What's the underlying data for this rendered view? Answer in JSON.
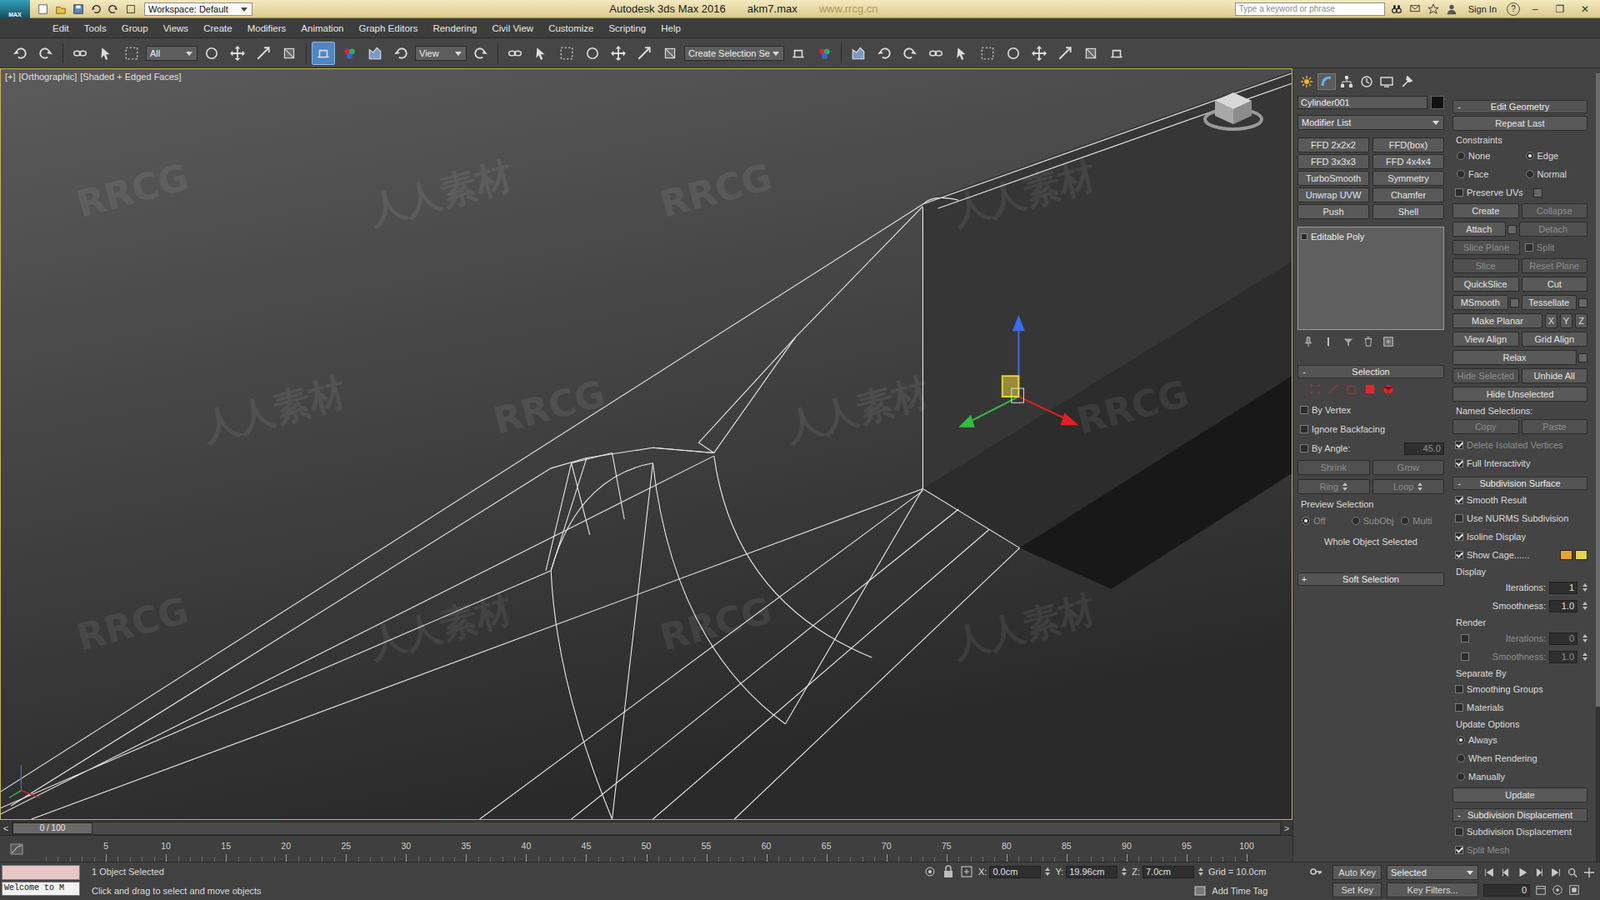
{
  "window": {
    "logo": "MAX",
    "workspace": "Workspace: Default",
    "title": "Autodesk 3ds Max 2016",
    "file": "akm7.max",
    "watermark_url": "www.rrcg.cn",
    "search_placeholder": "Type a keyword or phrase",
    "sign_in": "Sign In",
    "help": "?",
    "controls": [
      "–",
      "❐",
      "✕"
    ]
  },
  "menu": [
    "Edit",
    "Tools",
    "Group",
    "Views",
    "Create",
    "Modifiers",
    "Animation",
    "Graph Editors",
    "Rendering",
    "Civil View",
    "Customize",
    "Scripting",
    "Help"
  ],
  "toolbar": [
    {
      "kind": "tool",
      "selected": false
    },
    {
      "kind": "tool",
      "selected": false
    },
    {
      "kind": "sep"
    },
    {
      "kind": "tool",
      "selected": false
    },
    {
      "kind": "tool",
      "selected": false
    },
    {
      "kind": "tool",
      "selected": false
    },
    {
      "kind": "dropdown",
      "label": "All"
    },
    {
      "kind": "tool",
      "selected": false
    },
    {
      "kind": "tool",
      "selected": false
    },
    {
      "kind": "tool",
      "selected": false
    },
    {
      "kind": "tool",
      "selected": false
    },
    {
      "kind": "sep"
    },
    {
      "kind": "tool",
      "selected": true
    },
    {
      "kind": "tool",
      "selected": false
    },
    {
      "kind": "tool",
      "selected": false
    },
    {
      "kind": "tool",
      "selected": false
    },
    {
      "kind": "dropdown",
      "label": "View"
    },
    {
      "kind": "tool",
      "selected": false
    },
    {
      "kind": "sep"
    },
    {
      "kind": "tool",
      "selected": false
    },
    {
      "kind": "tool",
      "selected": false
    },
    {
      "kind": "tool",
      "selected": false
    },
    {
      "kind": "tool",
      "selected": false
    },
    {
      "kind": "tool",
      "selected": false
    },
    {
      "kind": "tool",
      "selected": false
    },
    {
      "kind": "tool",
      "selected": false
    },
    {
      "kind": "dropdown",
      "label": "Create Selection Se"
    },
    {
      "kind": "tool",
      "selected": false
    },
    {
      "kind": "tool",
      "selected": false
    },
    {
      "kind": "sep"
    },
    {
      "kind": "tool",
      "selected": false
    },
    {
      "kind": "tool",
      "selected": false
    },
    {
      "kind": "tool",
      "selected": false
    },
    {
      "kind": "tool",
      "selected": false
    },
    {
      "kind": "tool",
      "selected": false
    },
    {
      "kind": "tool",
      "selected": false
    },
    {
      "kind": "tool",
      "selected": false
    },
    {
      "kind": "tool",
      "selected": false
    },
    {
      "kind": "tool",
      "selected": false
    },
    {
      "kind": "tool",
      "selected": false
    },
    {
      "kind": "tool",
      "selected": false
    }
  ],
  "viewport": {
    "labels": [
      "[+]",
      "[Orthographic]",
      "[Shaded + Edged Faces]"
    ],
    "watermarks": [
      "RRCG",
      "人人素材",
      "RRCG",
      "人人素材",
      "人人素材",
      "RRCG",
      "人人素材",
      "RRCG",
      "RRCG",
      "人人素材",
      "RRCG",
      "人人素材"
    ]
  },
  "command_panel": {
    "tabs": [
      {
        "kind": "create",
        "selected": false
      },
      {
        "kind": "modify",
        "selected": true
      },
      {
        "kind": "hierarchy",
        "selected": false
      },
      {
        "kind": "motion",
        "selected": false
      },
      {
        "kind": "display",
        "selected": false
      },
      {
        "kind": "utilities",
        "selected": false
      }
    ],
    "object_name": "Cylinder001",
    "modifier_list": "Modifier List",
    "modifier_buttons": [
      "FFD 2x2x2",
      "FFD(box)",
      "FFD 3x3x3",
      "FFD 4x4x4",
      "TurboSmooth",
      "Symmetry",
      "Unwrap UVW",
      "Chamfer",
      "Push",
      "Shell"
    ],
    "stack": [
      {
        "label": "Editable Poly",
        "selected": false
      }
    ],
    "left_rows": [
      {
        "kind": "header",
        "sign": "-",
        "title": "Selection"
      },
      {
        "kind": "subobj"
      },
      {
        "kind": "row",
        "items": [
          {
            "kind": "check",
            "label": "By Vertex",
            "checked": false,
            "disabled": false
          }
        ]
      },
      {
        "kind": "row",
        "items": [
          {
            "kind": "check",
            "label": "Ignore Backfacing",
            "checked": false,
            "disabled": false
          }
        ]
      },
      {
        "kind": "row",
        "items": [
          {
            "kind": "check",
            "label": "By Angle:",
            "checked": false,
            "disabled": false
          },
          {
            "kind": "field",
            "value": "45.0",
            "disabled": true
          }
        ]
      },
      {
        "kind": "row",
        "items": [
          {
            "kind": "button",
            "label": "Shrink",
            "disabled": true
          },
          {
            "kind": "button",
            "label": "Grow",
            "disabled": true
          }
        ]
      },
      {
        "kind": "row",
        "items": [
          {
            "kind": "button",
            "label": "Ring",
            "disabled": true,
            "spinner": true
          },
          {
            "kind": "button",
            "label": "Loop",
            "disabled": true,
            "spinner": true
          }
        ]
      },
      {
        "kind": "label",
        "label": "Preview Selection"
      },
      {
        "kind": "row",
        "items": [
          {
            "kind": "radio",
            "label": "Off",
            "selected": true,
            "disabled": true
          },
          {
            "kind": "radio",
            "label": "SubObj",
            "selected": false,
            "disabled": true
          },
          {
            "kind": "radio",
            "label": "Multi",
            "selected": false,
            "disabled": true
          }
        ]
      },
      {
        "kind": "note",
        "label": "Whole Object Selected"
      },
      {
        "kind": "header",
        "sign": "+",
        "title": "Soft Selection"
      }
    ],
    "right_rows": [
      {
        "kind": "header",
        "sign": "-",
        "title": "Edit Geometry"
      },
      {
        "kind": "row",
        "items": [
          {
            "kind": "button",
            "label": "Repeat Last",
            "disabled": false
          }
        ]
      },
      {
        "kind": "label",
        "label": "Constraints"
      },
      {
        "kind": "row",
        "items": [
          {
            "kind": "radio",
            "label": "None",
            "selected": false,
            "disabled": false
          },
          {
            "kind": "radio",
            "label": "Edge",
            "selected": true,
            "disabled": false
          }
        ]
      },
      {
        "kind": "row",
        "items": [
          {
            "kind": "radio",
            "label": "Face",
            "selected": false,
            "disabled": false
          },
          {
            "kind": "radio",
            "label": "Normal",
            "selected": false,
            "disabled": false
          }
        ]
      },
      {
        "kind": "row",
        "items": [
          {
            "kind": "check",
            "label": "Preserve UVs",
            "checked": false,
            "disabled": false,
            "option": true
          }
        ]
      },
      {
        "kind": "row",
        "items": [
          {
            "kind": "button",
            "label": "Create",
            "disabled": false
          },
          {
            "kind": "button",
            "label": "Collapse",
            "disabled": true
          }
        ]
      },
      {
        "kind": "row",
        "items": [
          {
            "kind": "button",
            "label": "Attach",
            "disabled": false,
            "option": true
          },
          {
            "kind": "button",
            "label": "Detach",
            "disabled": true
          }
        ]
      },
      {
        "kind": "row",
        "items": [
          {
            "kind": "button",
            "label": "Slice Plane",
            "disabled": true
          },
          {
            "kind": "check",
            "label": "Split",
            "checked": false,
            "disabled": true
          }
        ]
      },
      {
        "kind": "row",
        "items": [
          {
            "kind": "button",
            "label": "Slice",
            "disabled": true
          },
          {
            "kind": "button",
            "label": "Reset Plane",
            "disabled": true
          }
        ]
      },
      {
        "kind": "row",
        "items": [
          {
            "kind": "button",
            "label": "QuickSlice",
            "disabled": false
          },
          {
            "kind": "button",
            "label": "Cut",
            "disabled": false
          }
        ]
      },
      {
        "kind": "row",
        "items": [
          {
            "kind": "button",
            "label": "MSmooth",
            "disabled": false,
            "option": true
          },
          {
            "kind": "button",
            "label": "Tessellate",
            "disabled": false,
            "option": true
          }
        ]
      },
      {
        "kind": "row",
        "items": [
          {
            "kind": "button",
            "label": "Make Planar",
            "disabled": false
          },
          {
            "kind": "mini",
            "label": "X"
          },
          {
            "kind": "mini",
            "label": "Y"
          },
          {
            "kind": "mini",
            "label": "Z"
          }
        ]
      },
      {
        "kind": "row",
        "items": [
          {
            "kind": "button",
            "label": "View Align",
            "disabled": false
          },
          {
            "kind": "button",
            "label": "Grid Align",
            "disabled": false
          }
        ]
      },
      {
        "kind": "row",
        "items": [
          {
            "kind": "button",
            "label": "Relax",
            "disabled": false,
            "option": true
          }
        ]
      },
      {
        "kind": "row",
        "items": [
          {
            "kind": "button",
            "label": "Hide Selected",
            "disabled": true
          },
          {
            "kind": "button",
            "label": "Unhide All",
            "disabled": false
          }
        ]
      },
      {
        "kind": "row",
        "items": [
          {
            "kind": "button",
            "label": "Hide Unselected",
            "disabled": false
          }
        ]
      },
      {
        "kind": "label",
        "label": "Named Selections:"
      },
      {
        "kind": "row",
        "items": [
          {
            "kind": "button",
            "label": "Copy",
            "disabled": true
          },
          {
            "kind": "button",
            "label": "Paste",
            "disabled": true
          }
        ]
      },
      {
        "kind": "row",
        "items": [
          {
            "kind": "check",
            "label": "Delete Isolated Vertices",
            "checked": true,
            "disabled": true
          }
        ]
      },
      {
        "kind": "row",
        "items": [
          {
            "kind": "check",
            "label": "Full Interactivity",
            "checked": true,
            "disabled": false
          }
        ]
      },
      {
        "kind": "header",
        "sign": "-",
        "title": "Subdivision Surface"
      },
      {
        "kind": "row",
        "items": [
          {
            "kind": "check",
            "label": "Smooth Result",
            "checked": true,
            "disabled": false
          }
        ]
      },
      {
        "kind": "row",
        "items": [
          {
            "kind": "check",
            "label": "Use NURMS Subdivision",
            "checked": false,
            "disabled": false
          }
        ]
      },
      {
        "kind": "row",
        "items": [
          {
            "kind": "check",
            "label": "Isoline Display",
            "checked": true,
            "disabled": false
          }
        ]
      },
      {
        "kind": "row",
        "items": [
          {
            "kind": "check",
            "label": "Show Cage......",
            "checked": true,
            "disabled": false
          },
          {
            "kind": "swatch",
            "color": "#f0a32a"
          },
          {
            "kind": "swatch",
            "color": "#e3d34a"
          }
        ]
      },
      {
        "kind": "label",
        "label": "Display"
      },
      {
        "kind": "spinner",
        "label": "Iterations:",
        "value": "1",
        "disabled": false
      },
      {
        "kind": "spinner",
        "label": "Smoothness:",
        "value": "1.0",
        "disabled": false
      },
      {
        "kind": "label",
        "label": "Render"
      },
      {
        "kind": "spinner",
        "label": "Iterations:",
        "value": "0",
        "check": false,
        "disabled": true
      },
      {
        "kind": "spinner",
        "label": "Smoothness:",
        "value": "1.0",
        "check": false,
        "disabled": true
      },
      {
        "kind": "label",
        "label": "Separate By"
      },
      {
        "kind": "row",
        "items": [
          {
            "kind": "check",
            "label": "Smoothing Groups",
            "checked": false,
            "disabled": false
          }
        ]
      },
      {
        "kind": "row",
        "items": [
          {
            "kind": "check",
            "label": "Materials",
            "checked": false,
            "disabled": false
          }
        ]
      },
      {
        "kind": "label",
        "label": "Update Options"
      },
      {
        "kind": "row",
        "items": [
          {
            "kind": "radio",
            "label": "Always",
            "selected": true,
            "disabled": false
          }
        ]
      },
      {
        "kind": "row",
        "items": [
          {
            "kind": "radio",
            "label": "When Rendering",
            "selected": false,
            "disabled": false
          }
        ]
      },
      {
        "kind": "row",
        "items": [
          {
            "kind": "radio",
            "label": "Manually",
            "selected": false,
            "disabled": false
          }
        ]
      },
      {
        "kind": "row",
        "items": [
          {
            "kind": "button",
            "label": "Update",
            "disabled": false
          }
        ]
      },
      {
        "kind": "header",
        "sign": "-",
        "title": "Subdivision Displacement"
      },
      {
        "kind": "row",
        "items": [
          {
            "kind": "check",
            "label": "Subdivision Displacement",
            "checked": false,
            "disabled": false
          }
        ]
      },
      {
        "kind": "row",
        "items": [
          {
            "kind": "check",
            "label": "Split Mesh",
            "checked": true,
            "disabled": true
          }
        ]
      }
    ]
  },
  "timeline": {
    "position": "0 / 100",
    "level": 0,
    "prev": "<",
    "next": ">",
    "ticks": [
      "5",
      "10",
      "15",
      "20",
      "25",
      "30",
      "35",
      "40",
      "45",
      "50",
      "55",
      "60",
      "65",
      "70",
      "75",
      "80",
      "85",
      "90",
      "95",
      "100"
    ]
  },
  "status": {
    "listener": "Welcome to M",
    "selection": "1 Object Selected",
    "prompt": "Click and drag to select and move objects",
    "coords": [
      {
        "label": "X:",
        "value": "0.0cm"
      },
      {
        "label": "Y:",
        "value": "19.96cm"
      },
      {
        "label": "Z:",
        "value": "7.0cm"
      }
    ],
    "grid": "Grid = 10.0cm",
    "add_time_tag": "Add Time Tag",
    "auto_key": "Auto Key",
    "key_mode": "Selected",
    "set_key": "Set Key",
    "key_filters": "Key Filters...",
    "frame": "0"
  }
}
